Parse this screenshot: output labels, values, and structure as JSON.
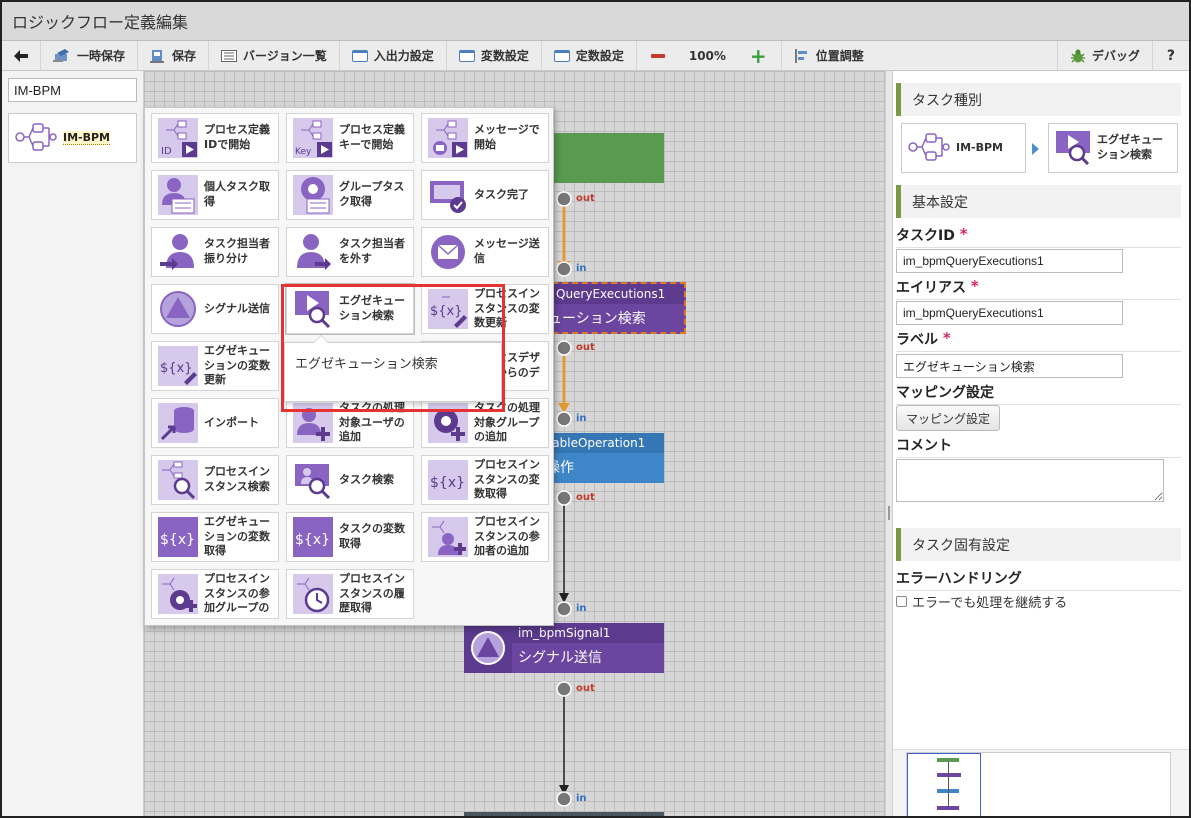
{
  "app": {
    "title": "ロジックフロー定義編集"
  },
  "toolbar": {
    "back": "",
    "temp_save": "一時保存",
    "save": "保存",
    "versions": "バージョン一覧",
    "io_settings": "入出力設定",
    "var_settings": "変数設定",
    "const_settings": "定数設定",
    "zoom": "100%",
    "position_adjust": "位置調整",
    "debug": "デバッグ",
    "help": "?"
  },
  "left_panel": {
    "category_input_value": "IM-BPM",
    "category_item": "IM-BPM"
  },
  "palette": {
    "items": [
      {
        "label": "プロセス定義\nIDで開始",
        "icon": "process-id-start"
      },
      {
        "label": "プロセス定義\nキーで開始",
        "icon": "process-key-start"
      },
      {
        "label": "メッセージで\n開始",
        "icon": "message-start"
      },
      {
        "label": "個人タスク取\n得",
        "icon": "personal-task"
      },
      {
        "label": "グループタス\nク取得",
        "icon": "group-task"
      },
      {
        "label": "タスク完了",
        "icon": "task-complete"
      },
      {
        "label": "タスク担当者\n振り分け",
        "icon": "assign-user"
      },
      {
        "label": "タスク担当者\nを外す",
        "icon": "unassign-user"
      },
      {
        "label": "メッセージ送\n信",
        "icon": "message-send"
      },
      {
        "label": "シグナル送信",
        "icon": "signal-send"
      },
      {
        "label": "エグゼキュー\nション検索",
        "icon": "execution-search"
      },
      {
        "label": "プロセスイン\nスタンスの変\n数更新",
        "icon": "variable-update"
      },
      {
        "label": "エグゼキュー\nションの変数\n更新",
        "icon": "exec-variable-update"
      },
      {
        "label": "",
        "icon": "hidden-item"
      },
      {
        "label": "プロセスデザ\nイナからのデ",
        "icon": "designer-deploy"
      },
      {
        "label": "インポート",
        "icon": "import"
      },
      {
        "label": "タスクの処理\n対象ユーザの\n追加",
        "icon": "add-target-user"
      },
      {
        "label": "タスクの処理\n対象グループ\nの追加",
        "icon": "add-target-group"
      },
      {
        "label": "プロセスイン\nスタンス検索",
        "icon": "instance-search"
      },
      {
        "label": "タスク検索",
        "icon": "task-search"
      },
      {
        "label": "プロセスイン\nスタンスの変\n数取得",
        "icon": "instance-variable-get"
      },
      {
        "label": "エグゼキュー\nションの変数\n取得",
        "icon": "exec-variable-get"
      },
      {
        "label": "タスクの変数\n取得",
        "icon": "task-variable-get"
      },
      {
        "label": "プロセスイン\nスタンスの参\n加者の追加",
        "icon": "add-participant"
      },
      {
        "label": "プロセスイン\nスタンスの参\n加グループの",
        "icon": "add-participant-group"
      },
      {
        "label": "プロセスイン\nスタンスの履\n歴取得",
        "icon": "instance-history"
      }
    ],
    "tooltip": "エグゼキューション検索"
  },
  "canvas": {
    "ports": {
      "out": "out",
      "in": "in"
    },
    "nodes": [
      {
        "id": "",
        "label": ""
      },
      {
        "id": "QueryExecutions1",
        "label": "ューション検索"
      },
      {
        "id": "riableOperation1",
        "label": "操作"
      },
      {
        "id": "im_bpmSignal1",
        "label": "シグナル送信"
      }
    ]
  },
  "properties": {
    "task_type": {
      "header": "タスク種別",
      "category": "IM-BPM",
      "task": "エグゼキュー\nション検索"
    },
    "basic": {
      "header": "基本設定",
      "task_id_label": "タスクID",
      "task_id_value": "im_bpmQueryExecutions1",
      "alias_label": "エイリアス",
      "alias_value": "im_bpmQueryExecutions1",
      "label_label": "ラベル",
      "label_value": "エグゼキューション検索",
      "mapping_label": "マッピング設定",
      "mapping_button": "マッピング設定",
      "comment_label": "コメント",
      "comment_value": "",
      "required_mark": "*"
    },
    "specific": {
      "header": "タスク固有設定",
      "error_handling_label": "エラーハンドリング",
      "continue_on_error": "エラーでも処理を継続する"
    }
  },
  "colors": {
    "start_node": "#5a9a50",
    "purple_node": "#5c3a8e",
    "purple_node_body": "#6b45a0",
    "blue_node": "#3f86c8",
    "flow_orange": "#e09a30",
    "highlight": "#e53333",
    "icon_purple": "#8a64c2"
  }
}
